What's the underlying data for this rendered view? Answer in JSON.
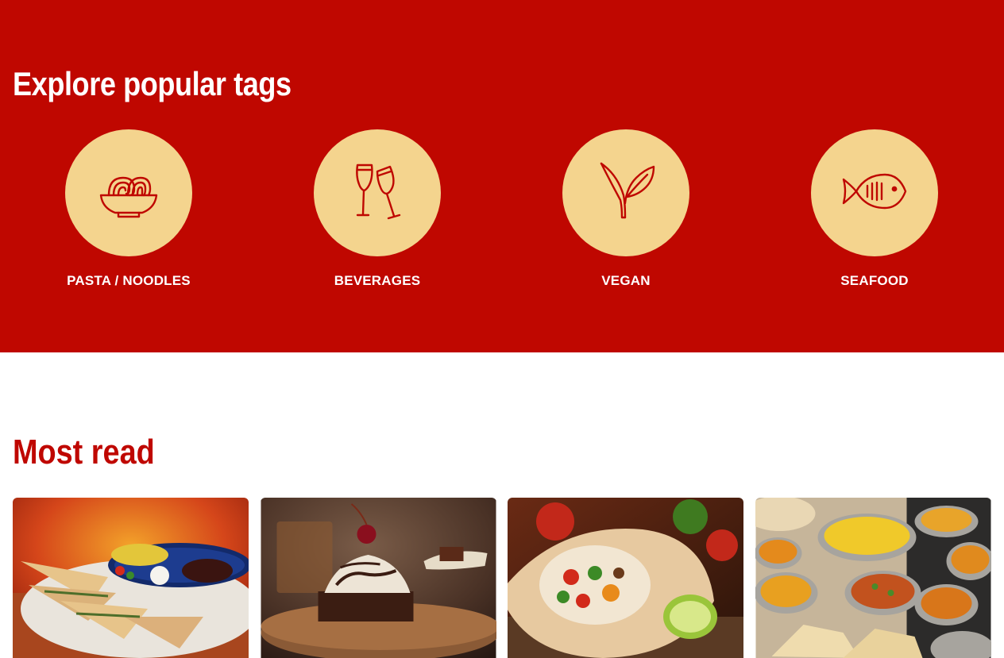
{
  "tags_section": {
    "heading": "Explore popular tags",
    "background_color": "#bf0700",
    "circle_color": "#f4d48e",
    "tags": [
      {
        "label": "PASTA / NOODLES",
        "icon": "noodle-bowl-icon"
      },
      {
        "label": "BEVERAGES",
        "icon": "champagne-glasses-icon"
      },
      {
        "label": "VEGAN",
        "icon": "sprout-icon"
      },
      {
        "label": "SEAFOOD",
        "icon": "fish-icon"
      }
    ]
  },
  "most_read": {
    "heading": "Most read",
    "cards": [
      {
        "image": "quesadilla-plate-photo"
      },
      {
        "image": "brownie-sundae-photo"
      },
      {
        "image": "burrito-wrap-photo"
      },
      {
        "image": "indian-curry-spread-photo"
      }
    ]
  }
}
